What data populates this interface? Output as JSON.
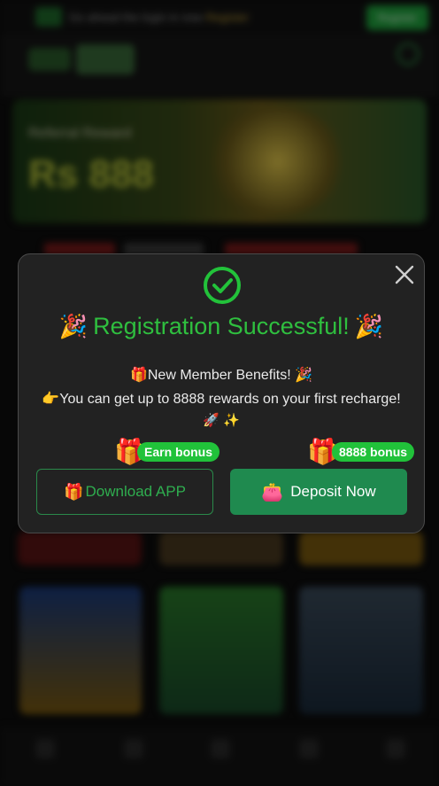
{
  "background": {
    "topbar_text": "Go ahead the login in now",
    "topbar_highlight": "Register",
    "topbar_button": "Register",
    "banner_subtitle": "Referral Reward",
    "banner_amount": "Rs 888"
  },
  "modal": {
    "title": "Registration Successful!",
    "title_emoji_left": "🎉",
    "title_emoji_right": "🎉",
    "benefits_line": "🎁New Member Benefits! 🎉",
    "rewards_line": "👉You can get up to 8888 rewards on your first recharge!",
    "emoji_line": "🚀 ✨",
    "left_badge": "Earn bonus",
    "right_badge": "8888 bonus",
    "download_button": "Download APP",
    "deposit_button": "Deposit Now",
    "icons": {
      "close": "close-icon",
      "success": "check-circle-icon",
      "gift": "gift-icon",
      "wallet": "wallet-icon"
    }
  },
  "colors": {
    "accent_green": "#2fbf3f",
    "badge_green": "#21c23a",
    "deposit_bg": "#1f8a4f",
    "modal_bg": "#222222"
  }
}
